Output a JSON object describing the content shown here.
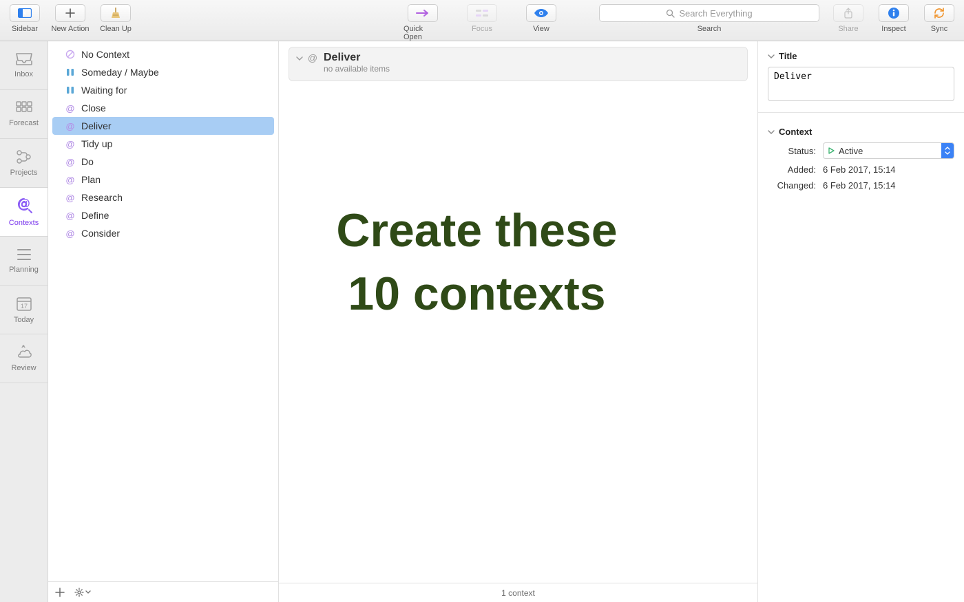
{
  "toolbar": {
    "left": [
      {
        "id": "sidebar",
        "label": "Sidebar"
      },
      {
        "id": "new-action",
        "label": "New Action"
      },
      {
        "id": "clean-up",
        "label": "Clean Up"
      }
    ],
    "center": [
      {
        "id": "quick-open",
        "label": "Quick Open"
      },
      {
        "id": "focus",
        "label": "Focus",
        "disabled": true
      },
      {
        "id": "view",
        "label": "View"
      }
    ],
    "search": {
      "placeholder": "Search Everything",
      "label": "Search"
    },
    "right": [
      {
        "id": "share",
        "label": "Share",
        "disabled": true
      },
      {
        "id": "inspect",
        "label": "Inspect"
      },
      {
        "id": "sync",
        "label": "Sync"
      }
    ]
  },
  "leftnav": [
    {
      "id": "inbox",
      "label": "Inbox"
    },
    {
      "id": "forecast",
      "label": "Forecast"
    },
    {
      "id": "projects",
      "label": "Projects"
    },
    {
      "id": "contexts",
      "label": "Contexts",
      "selected": true
    },
    {
      "id": "planning",
      "label": "Planning"
    },
    {
      "id": "today",
      "label": "Today",
      "badge": "17"
    },
    {
      "id": "review",
      "label": "Review"
    }
  ],
  "contexts": [
    {
      "type": "no",
      "label": "No Context"
    },
    {
      "type": "pause",
      "label": "Someday / Maybe"
    },
    {
      "type": "pause",
      "label": "Waiting for"
    },
    {
      "type": "at",
      "label": "Close"
    },
    {
      "type": "at",
      "label": "Deliver",
      "selected": true
    },
    {
      "type": "at",
      "label": "Tidy up"
    },
    {
      "type": "at",
      "label": "Do"
    },
    {
      "type": "at",
      "label": "Plan"
    },
    {
      "type": "at",
      "label": "Research"
    },
    {
      "type": "at",
      "label": "Define"
    },
    {
      "type": "at",
      "label": "Consider"
    }
  ],
  "main": {
    "headerTitle": "Deliver",
    "headerSubtitle": "no available items",
    "statusbar": "1 context",
    "annotationLine1": "Create these",
    "annotationLine2": "10 contexts"
  },
  "inspector": {
    "titleSectionLabel": "Title",
    "titleValue": "Deliver",
    "contextSectionLabel": "Context",
    "statusLabel": "Status:",
    "statusValue": "Active",
    "addedLabel": "Added:",
    "addedValue": "6 Feb 2017, 15:14",
    "changedLabel": "Changed:",
    "changedValue": "6 Feb 2017, 15:14"
  }
}
